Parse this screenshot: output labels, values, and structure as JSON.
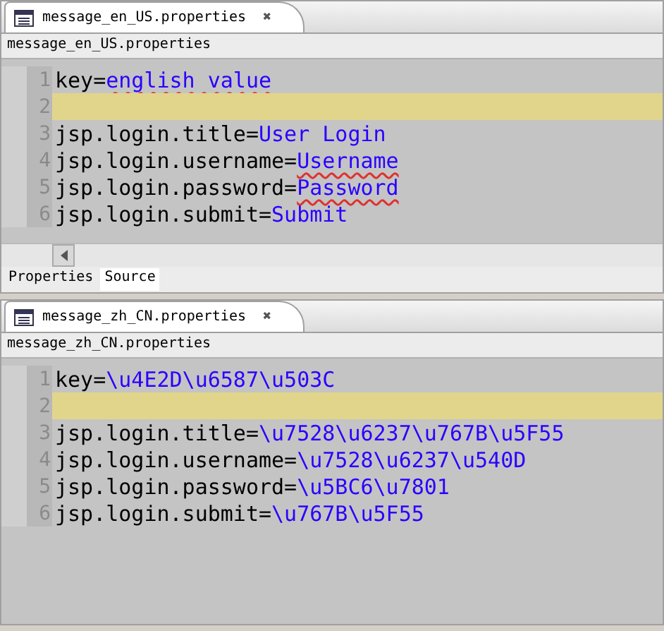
{
  "editors": [
    {
      "tab": {
        "title": "message_en_US.properties",
        "close": "✖"
      },
      "file_label": "message_en_US.properties",
      "lines": [
        {
          "number": "1",
          "key": "key=",
          "value": "english value",
          "misspelled": true,
          "current": false
        },
        {
          "number": "2",
          "current": true
        },
        {
          "number": "3",
          "key": "jsp.login.title=",
          "value": "User Login",
          "misspelled": false,
          "current": false
        },
        {
          "number": "4",
          "key": "jsp.login.username=",
          "value": "Username",
          "misspelled": true,
          "current": false
        },
        {
          "number": "5",
          "key": "jsp.login.password=",
          "value": "Password",
          "misspelled": true,
          "current": false
        },
        {
          "number": "6",
          "key": "jsp.login.submit=",
          "value": "Submit",
          "misspelled": false,
          "current": false
        }
      ],
      "bottom_tabs": [
        {
          "label": "Properties",
          "selected": false
        },
        {
          "label": "Source",
          "selected": true
        }
      ]
    },
    {
      "tab": {
        "title": "message_zh_CN.properties",
        "close": "✖"
      },
      "file_label": "message_zh_CN.properties",
      "lines": [
        {
          "number": "1",
          "key": "key=",
          "value": "\\u4E2D\\u6587\\u503C",
          "misspelled": false,
          "current": false
        },
        {
          "number": "2",
          "current": true
        },
        {
          "number": "3",
          "key": "jsp.login.title=",
          "value": "\\u7528\\u6237\\u767B\\u5F55",
          "misspelled": false,
          "current": false
        },
        {
          "number": "4",
          "key": "jsp.login.username=",
          "value": "\\u7528\\u6237\\u540D",
          "misspelled": false,
          "current": false
        },
        {
          "number": "5",
          "key": "jsp.login.password=",
          "value": "\\u5BC6\\u7801",
          "misspelled": false,
          "current": false
        },
        {
          "number": "6",
          "key": "jsp.login.submit=",
          "value": "\\u767B\\u5F55",
          "misspelled": false,
          "current": false
        }
      ]
    }
  ]
}
